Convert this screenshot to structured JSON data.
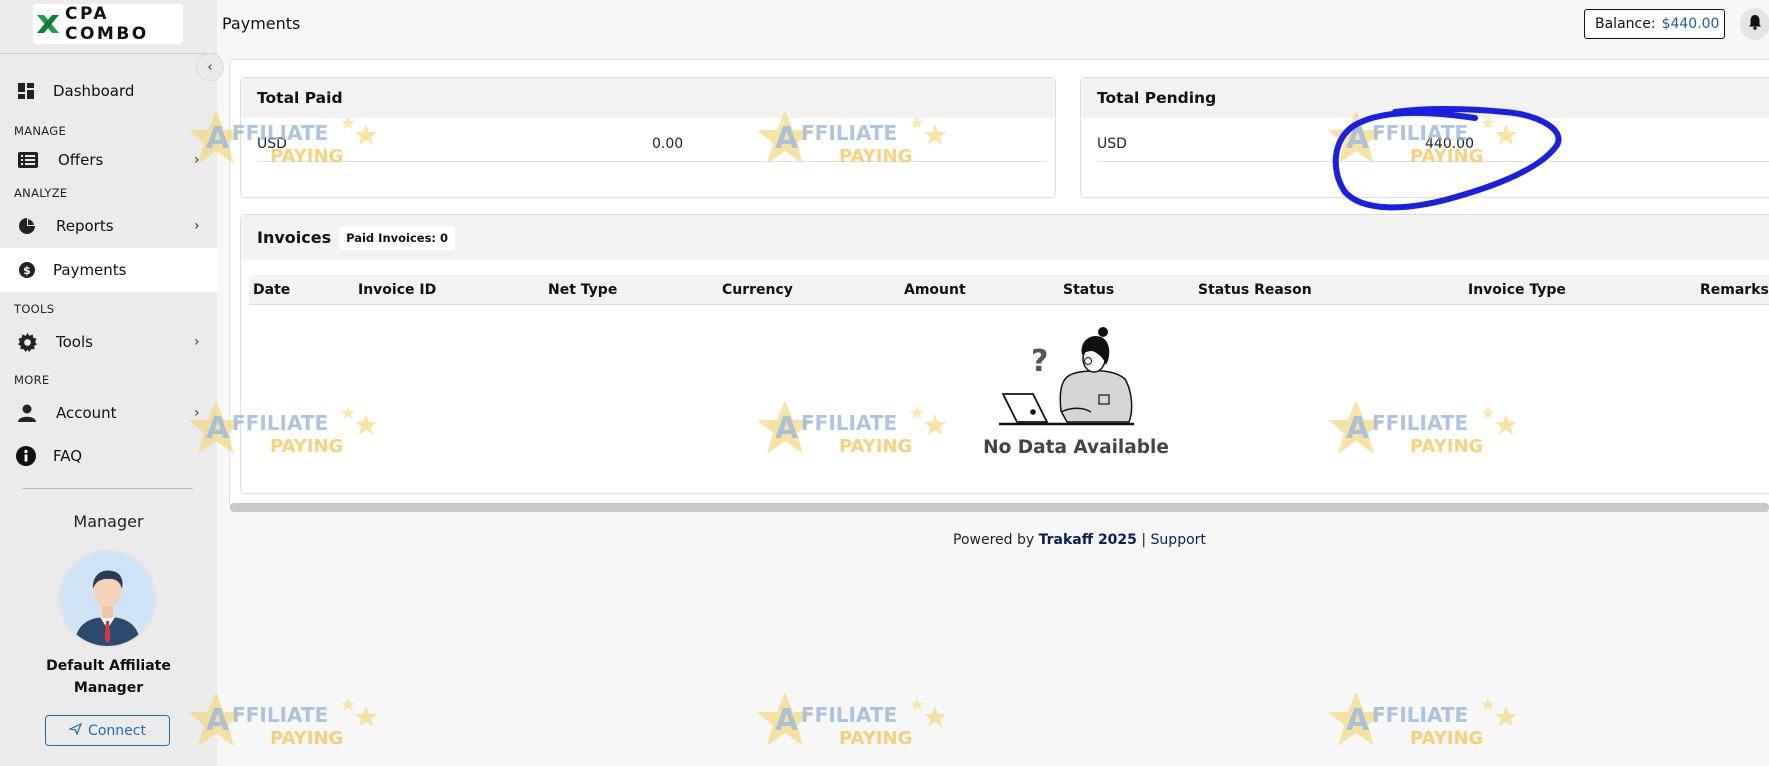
{
  "brand": {
    "name": "CPA COMBO"
  },
  "header": {
    "page_title": "Payments",
    "balance_label": "Balance:",
    "balance_value": "$440.00"
  },
  "sidebar": {
    "sections": {
      "manage": "MANAGE",
      "analyze": "ANALYZE",
      "tools": "TOOLS",
      "more": "MORE"
    },
    "items": [
      {
        "label": "Dashboard",
        "icon": "dashboard-icon"
      },
      {
        "label": "Offers",
        "icon": "list-icon"
      },
      {
        "label": "Reports",
        "icon": "pie-chart-icon"
      },
      {
        "label": "Payments",
        "icon": "dollar-icon"
      },
      {
        "label": "Tools",
        "icon": "gear-icon"
      },
      {
        "label": "Account",
        "icon": "user-icon"
      },
      {
        "label": "FAQ",
        "icon": "info-icon"
      }
    ],
    "manager": {
      "title": "Manager",
      "name_line1": "Default Affiliate",
      "name_line2": "Manager",
      "connect_label": "Connect"
    }
  },
  "cards": {
    "total_paid": {
      "title": "Total Paid",
      "currency": "USD",
      "amount": "0.00"
    },
    "total_pending": {
      "title": "Total Pending",
      "currency": "USD",
      "amount": "440.00"
    }
  },
  "invoices": {
    "title": "Invoices",
    "badge": "Paid Invoices: 0",
    "columns": [
      "Date",
      "Invoice ID",
      "Net Type",
      "Currency",
      "Amount",
      "Status",
      "Status Reason",
      "Invoice Type",
      "Remarks"
    ],
    "rows": [],
    "empty_text": "No Data Available"
  },
  "footer": {
    "powered_by": "Powered by",
    "brand": "Trakaff 2025",
    "separator": "|",
    "support": "Support"
  },
  "watermark": {
    "line1": "AFFILIATE",
    "line2": "PAYING"
  },
  "colors": {
    "accent": "#1f5fa8",
    "sidebar_bg": "#ecebeb",
    "annotation": "#1a1fe0",
    "logo_green": "#1aa14a"
  }
}
